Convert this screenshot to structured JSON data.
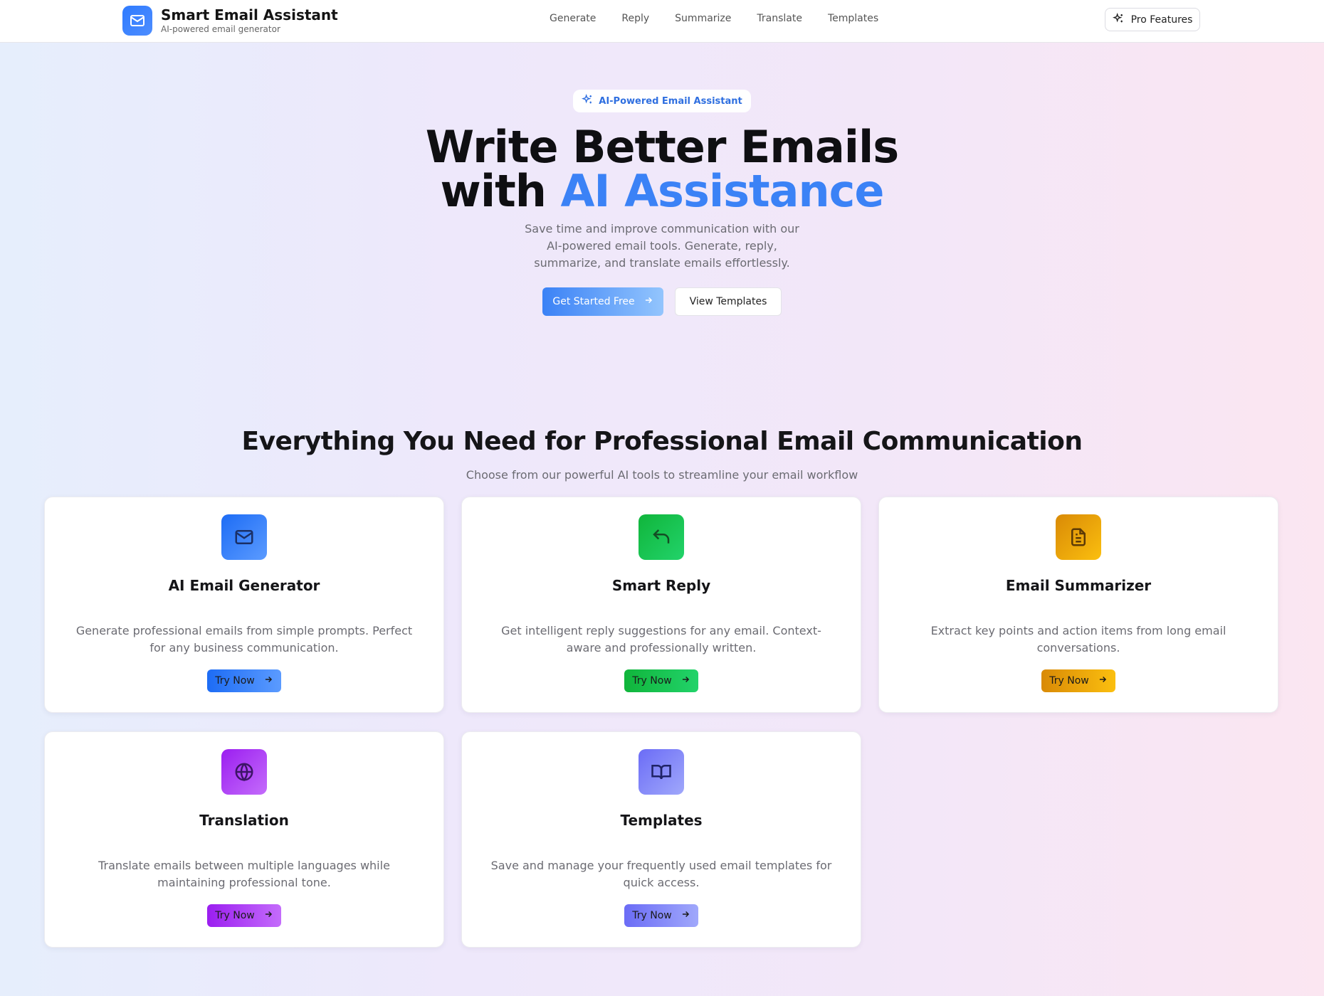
{
  "header": {
    "brand_title": "Smart Email Assistant",
    "brand_subtitle": "AI-powered email generator",
    "nav": [
      "Generate",
      "Reply",
      "Summarize",
      "Translate",
      "Templates"
    ],
    "pro_label": "Pro Features"
  },
  "hero": {
    "badge": "AI-Powered Email Assistant",
    "title_main": "Write Better Emails with ",
    "title_accent": "AI Assistance",
    "description": "Save time and improve communication with our AI-powered email tools. Generate, reply, summarize, and translate emails effortlessly.",
    "primary_label": "Get Started Free",
    "secondary_label": "View Templates"
  },
  "features": {
    "title": "Everything You Need for Professional Email Communication",
    "subtitle": "Choose from our powerful AI tools to streamline your email workflow",
    "try_label": "Try Now",
    "cards": [
      {
        "title": "AI Email Generator",
        "desc": "Generate professional emails from simple prompts. Perfect for any business communication.",
        "icon": "mail-icon",
        "color_from": "#1d6cf5",
        "color_to": "#5b9bff"
      },
      {
        "title": "Smart Reply",
        "desc": "Get intelligent reply suggestions for any email. Context-aware and professionally written.",
        "icon": "reply-icon",
        "color_from": "#10b53b",
        "color_to": "#22d36a"
      },
      {
        "title": "Email Summarizer",
        "desc": "Extract key points and action items from long email conversations.",
        "icon": "document-icon",
        "color_from": "#d98a06",
        "color_to": "#fbbf0f"
      },
      {
        "title": "Translation",
        "desc": "Translate emails between multiple languages while maintaining professional tone.",
        "icon": "globe-icon",
        "color_from": "#9b1ef0",
        "color_to": "#c46cfb"
      },
      {
        "title": "Templates",
        "desc": "Save and manage your frequently used email templates for quick access.",
        "icon": "book-icon",
        "color_from": "#6b6cf6",
        "color_to": "#a0a8fb"
      }
    ]
  }
}
